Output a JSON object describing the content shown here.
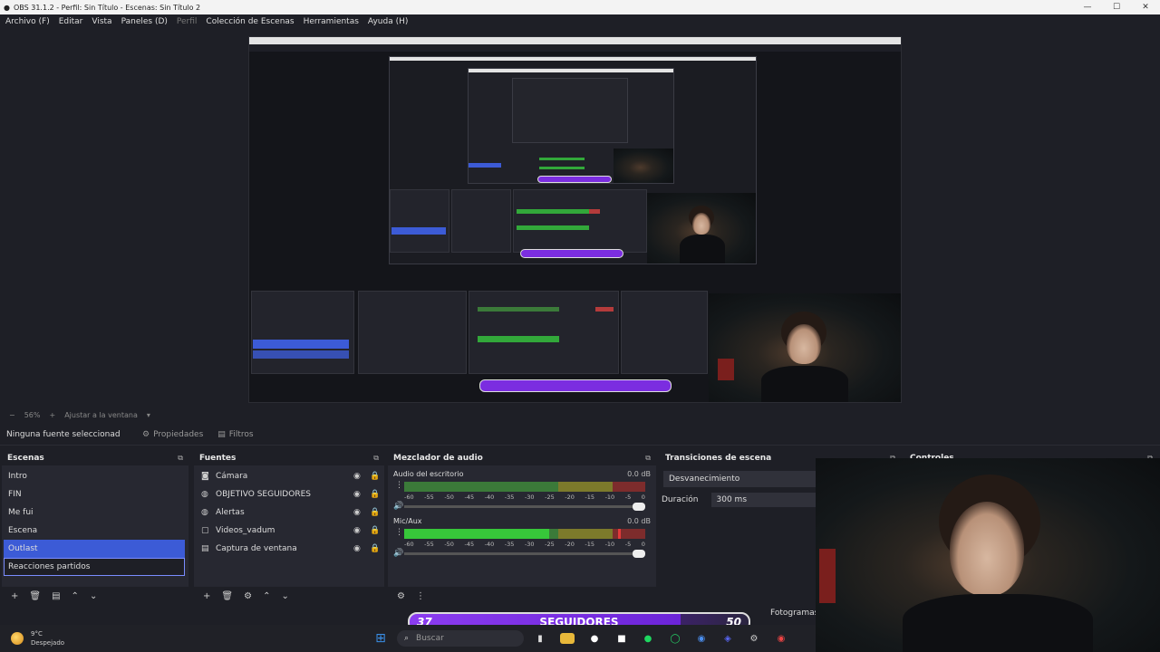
{
  "window": {
    "title": "OBS 31.1.2 - Perfil: Sin Título - Escenas: Sin Título 2",
    "minimize": "—",
    "maximize": "☐",
    "close": "✕"
  },
  "menu": {
    "file": "Archivo (F)",
    "edit": "Editar",
    "view": "Vista",
    "docks": "Paneles (D)",
    "profile": "Perfil",
    "scene_collection": "Colección de Escenas",
    "tools": "Herramientas",
    "help": "Ayuda (H)"
  },
  "zoom": {
    "level": "56%",
    "plus": "+",
    "fit": "Ajustar a la ventana"
  },
  "context_bar": {
    "no_source": "Ninguna fuente seleccionad",
    "properties": "Propiedades",
    "filters": "Filtros"
  },
  "scenes": {
    "title": "Escenas",
    "items": [
      "Intro",
      "FIN",
      "Me fui",
      "Escena",
      "Outlast",
      "Reacciones partidos"
    ]
  },
  "sources": {
    "title": "Fuentes",
    "items": [
      {
        "label": "Cámara",
        "icon": "camera-icon"
      },
      {
        "label": "OBJETIVO SEGUIDORES",
        "icon": "globe-icon"
      },
      {
        "label": "Alertas",
        "icon": "globe-icon"
      },
      {
        "label": "Videos_vadum",
        "icon": "window-icon"
      },
      {
        "label": "Captura de ventana",
        "icon": "window-icon"
      }
    ]
  },
  "mixer": {
    "title": "Mezclador de audio",
    "channels": [
      {
        "name": "Audio del escritorio",
        "db": "0.0 dB",
        "level": 0.0
      },
      {
        "name": "Mic/Aux",
        "db": "0.0 dB",
        "level": 0.6
      }
    ],
    "ticks": [
      "-60",
      "-55",
      "-50",
      "-45",
      "-40",
      "-35",
      "-30",
      "-25",
      "-20",
      "-15",
      "-10",
      "-5",
      "0"
    ]
  },
  "transitions": {
    "title": "Transiciones de escena",
    "selected": "Desvanecimiento",
    "duration_label": "Duración",
    "duration_value": "300 ms"
  },
  "controls": {
    "title": "Controles"
  },
  "status": {
    "fps_label": "Fotogramas"
  },
  "overlay": {
    "count": "37",
    "label": "SEGUIDORES",
    "goal": "50"
  },
  "taskbar": {
    "temp": "9°C",
    "weather": "Despejado",
    "search": "Buscar"
  },
  "colors": {
    "selection": "#3c5bd6",
    "overlay_purple": "#7b2de0",
    "meter_green": "#37c73a"
  }
}
